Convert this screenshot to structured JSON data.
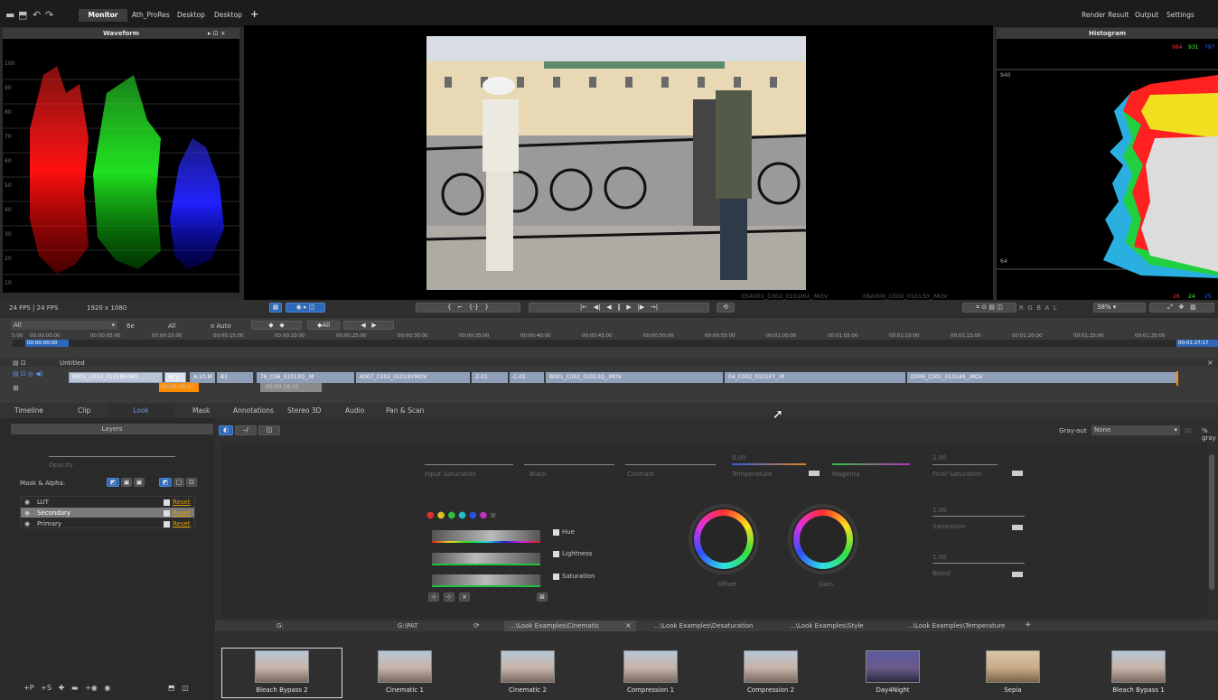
{
  "topbar": {
    "tabs": [
      "Monitor",
      "Ath_ProRes",
      "Desktop",
      "Desktop"
    ],
    "add": "+",
    "right": [
      "Render Result",
      "Output",
      "Settings"
    ]
  },
  "waveform": {
    "title": "Waveform",
    "scale": [
      "100",
      "90",
      "80",
      "70",
      "60",
      "50",
      "40",
      "30",
      "20",
      "10"
    ]
  },
  "histogram": {
    "title": "Histogram",
    "top_values": [
      "984",
      "931",
      "797"
    ],
    "bottom_values": [
      "26",
      "24",
      "25"
    ],
    "marker_top": "940",
    "marker_bottom": "64"
  },
  "viewer": {
    "clip_a": "G5A001_C002_0101HU_.MOV",
    "clip_b": "06A006_C002_010130_.MOV",
    "fps_info": "24 FPS | 24 FPS",
    "resolution": "1920 x 1080",
    "zoom": "38%",
    "channels": [
      "R",
      "G",
      "B",
      "A",
      "L"
    ]
  },
  "timeline": {
    "filter": "All",
    "controls": [
      "6e",
      "All",
      "o Auto",
      "All"
    ],
    "ruler": [
      "5:00",
      "00:00:00:00",
      "00:00:05:00",
      "00:00:10:00",
      "00:00:15:00",
      "00:00:20:00",
      "00:00:25:00",
      "00:00:30:00",
      "00:00:35:00",
      "00:00:40:00",
      "00:00:45:00",
      "00:00:50:00",
      "00:00:55:00",
      "00:01:00:00",
      "00:01:05:00",
      "00:01:10:00",
      "00:01:15:00",
      "00:01:20:00",
      "00:01:25:00",
      "00:01:30:00"
    ],
    "current_tc": "00:00:00:00",
    "end_tc": "00:01:27:17",
    "track_name": "Untitled",
    "clips": [
      "B001_C010_0101BH.MO",
      "A-10.M",
      "B1",
      "76_C06_01013O_.M",
      "A007_C002_01019Y.MOV",
      "Z-01",
      "C-01",
      "B001_C002_01013Q_.MOV",
      "04_C002_0101EY_.M",
      "D006_C001_010149_.MOV"
    ],
    "tc_in": "00:00:09:11",
    "tc_out": "00:00:18:15"
  },
  "bottom_tabs": [
    "Timeline",
    "Clip",
    "Look",
    "Mask",
    "Annotations",
    "Stereo 3D",
    "Audio",
    "Pan & Scan"
  ],
  "layers": {
    "title": "Layers",
    "opacity": "Opacity",
    "mask_label": "Mask & Alpha:",
    "items": [
      {
        "name": "LUT",
        "reset": "Reset"
      },
      {
        "name": "Secondary",
        "reset": "Reset"
      },
      {
        "name": "Primary",
        "reset": "Reset"
      }
    ]
  },
  "grade": {
    "grayout_label": "Gray-out",
    "grayout_value": "None",
    "grayout_num": "30",
    "grayout_unit": "% gray",
    "sliders": [
      "Input Saturation",
      "Black",
      "Contrast",
      "Temperature",
      "Magenta",
      "Final Saturation"
    ],
    "temp_val": "0.00",
    "final_val": "1.00",
    "checks": [
      "Hue",
      "Lightness",
      "Saturation"
    ],
    "wheel_labels": [
      "Offset",
      "Gain"
    ],
    "right_sliders": [
      {
        "val": "1.00",
        "name": "Saturation"
      },
      {
        "val": "1.00",
        "name": "Blend"
      }
    ]
  },
  "looks": {
    "paths": [
      "G:",
      "G:\\PAT",
      "...\\Look Examples\\Cinematic",
      "...\\Look Examples\\Desaturation",
      "...\\Look Examples\\Style",
      "...\\Look Examples\\Temperature"
    ],
    "close": "×",
    "add": "+",
    "items": [
      "Bleach Bypass 2",
      "Cinematic 1",
      "Cinematic 2",
      "Compression 1",
      "Compression 2",
      "Day4Night",
      "Sepia",
      "Bleach Bypass 1"
    ]
  },
  "colors": {
    "accent": "#2f68b8",
    "clip": "#b9c4d6",
    "playhead": "#ff8c00",
    "reset": "#e0a000"
  }
}
